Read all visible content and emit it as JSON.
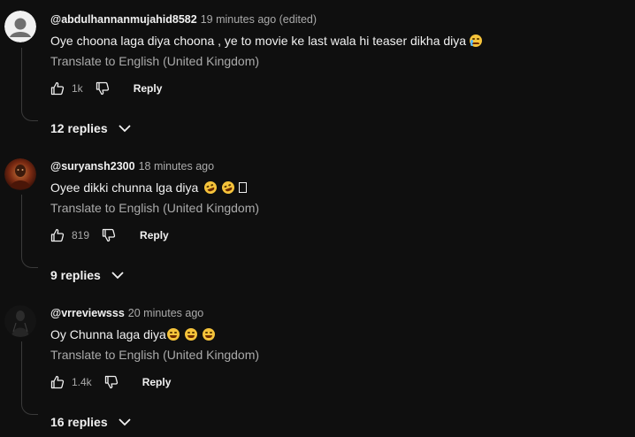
{
  "comments": [
    {
      "author": "@abdulhannanmujahid8582",
      "time": "19 minutes ago (edited)",
      "text": "Oye choona laga diya choona , ye to movie ke last wala hi teaser dikha diya",
      "emojis": [
        "crying-emoji"
      ],
      "translate": "Translate to English (United Kingdom)",
      "likes": "1k",
      "reply_label": "Reply",
      "replies_label": "12 replies",
      "avatar": "default-avatar"
    },
    {
      "author": "@suryansh2300",
      "time": "18 minutes ago",
      "text": "Oyee dikki chunna lga diya",
      "emojis": [
        "rofl-emoji",
        "rofl-emoji",
        "missing-glyph"
      ],
      "translate": "Translate to English (United Kingdom)",
      "likes": "819",
      "reply_label": "Reply",
      "replies_label": "9 replies",
      "avatar": "photo-avatar"
    },
    {
      "author": "@vrreviewsss",
      "time": "20 minutes ago",
      "text": "Oy Chunna laga diya",
      "emojis": [
        "joy-emoji",
        "joy-emoji",
        "joy-emoji"
      ],
      "translate": "Translate to English (United Kingdom)",
      "likes": "1.4k",
      "reply_label": "Reply",
      "replies_label": "16 replies",
      "avatar": "dark-figure-avatar"
    }
  ],
  "colors": {
    "background": "#0f0f0f",
    "text": "#f1f1f1",
    "secondary": "#aaaaaa"
  }
}
